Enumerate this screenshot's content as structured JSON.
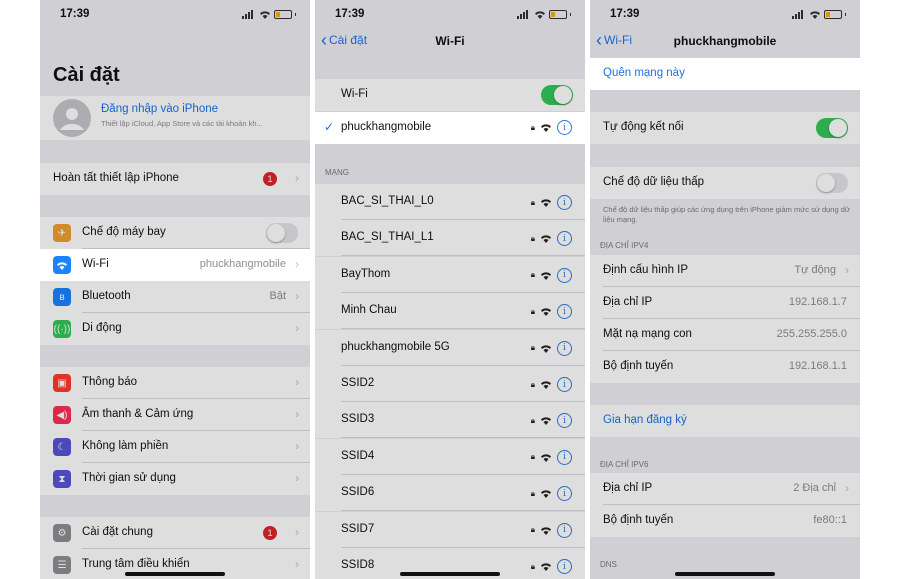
{
  "status": {
    "time": "17:39"
  },
  "panel1": {
    "title": "Cài đặt",
    "profile": {
      "name": "Đăng nhập vào iPhone",
      "subtitle": "Thiết lập iCloud, App Store và các tài khoản kh..."
    },
    "setup_row": {
      "label": "Hoàn tất thiết lập iPhone",
      "badge": "1"
    },
    "rows1": [
      {
        "label": "Chế độ máy bay",
        "icon": "airplane-icon",
        "color": "#f0a030"
      },
      {
        "label": "Wi-Fi",
        "value": "phuckhangmobile",
        "icon": "wifi-icon",
        "color": "#1a84ff"
      },
      {
        "label": "Bluetooth",
        "value": "Bật",
        "icon": "bluetooth-icon",
        "color": "#1a84ff"
      },
      {
        "label": "Di động",
        "icon": "cellular-icon",
        "color": "#34c759"
      }
    ],
    "rows2": [
      {
        "label": "Thông báo",
        "icon": "notifications-icon",
        "color": "#ff3b30"
      },
      {
        "label": "Âm thanh & Cảm ứng",
        "icon": "sound-icon",
        "color": "#ff2d55"
      },
      {
        "label": "Không làm phiền",
        "icon": "moon-icon",
        "color": "#5856d6"
      },
      {
        "label": "Thời gian sử dụng",
        "icon": "hourglass-icon",
        "color": "#5856d6"
      }
    ],
    "rows3": [
      {
        "label": "Cài đặt chung",
        "badge": "1",
        "icon": "gear-icon",
        "color": "#8e8e93"
      },
      {
        "label": "Trung tâm điều khiển",
        "icon": "control-center-icon",
        "color": "#8e8e93"
      }
    ]
  },
  "panel2": {
    "back": "Cài đặt",
    "title": "Wi-Fi",
    "wifi_label": "Wi-Fi",
    "connected": "phuckhangmobile",
    "section": "MẠNG",
    "networks": [
      "BAC_SI_THAI_L0",
      "BAC_SI_THAI_L1",
      "BayThom",
      "Minh Chau",
      "phuckhangmobile 5G",
      "SSID2",
      "SSID3",
      "SSID4",
      "SSID6",
      "SSID7",
      "SSID8"
    ]
  },
  "panel3": {
    "back": "Wi-Fi",
    "title": "phuckhangmobile",
    "forget": "Quên mạng này",
    "auto_join": "Tự động kết nối",
    "low_data": "Chế độ dữ liệu thấp",
    "low_data_desc": "Chế độ dữ liệu thấp giúp các ứng dụng trên iPhone giảm mức sử dụng dữ liệu mạng.",
    "ipv4_header": "ĐỊA CHỈ IPV4",
    "ipv4": [
      {
        "label": "Định cấu hình IP",
        "value": "Tự động"
      },
      {
        "label": "Địa chỉ IP",
        "value": "192.168.1.7"
      },
      {
        "label": "Mặt nạ mạng con",
        "value": "255.255.255.0"
      },
      {
        "label": "Bộ định tuyến",
        "value": "192.168.1.1"
      }
    ],
    "renew": "Gia hạn đăng ký",
    "ipv6_header": "ĐỊA CHỈ IPV6",
    "ipv6": [
      {
        "label": "Địa chỉ IP",
        "value": "2 Địa chỉ"
      },
      {
        "label": "Bộ định tuyến",
        "value": "fe80::1"
      }
    ],
    "dns_header": "DNS"
  }
}
